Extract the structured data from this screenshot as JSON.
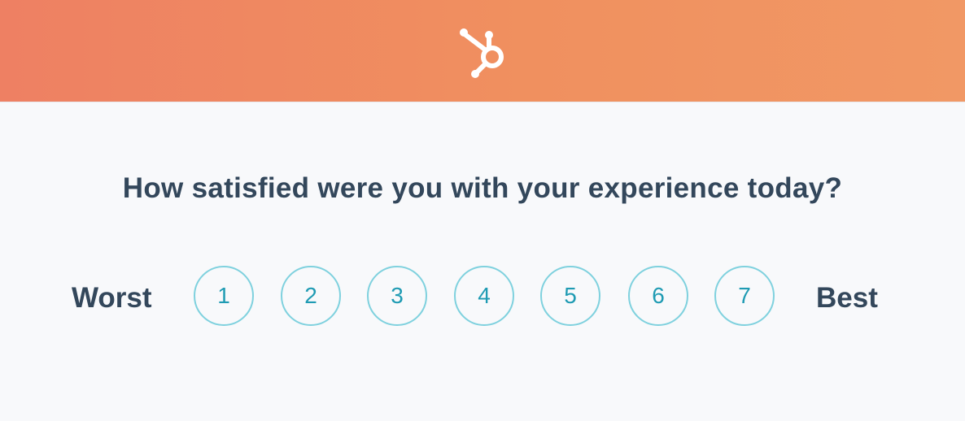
{
  "header": {
    "logo_icon": "hubspot-sprocket-icon",
    "gradient_start": "#ee8063",
    "gradient_end": "#f19865"
  },
  "survey": {
    "question": "How satisfied were you with your experience today?",
    "low_label": "Worst",
    "high_label": "Best",
    "options": [
      "1",
      "2",
      "3",
      "4",
      "5",
      "6",
      "7"
    ]
  },
  "colors": {
    "text": "#33475b",
    "option_border": "#7fd1de",
    "option_text": "#1f9bb3",
    "background": "#f8f9fb"
  }
}
